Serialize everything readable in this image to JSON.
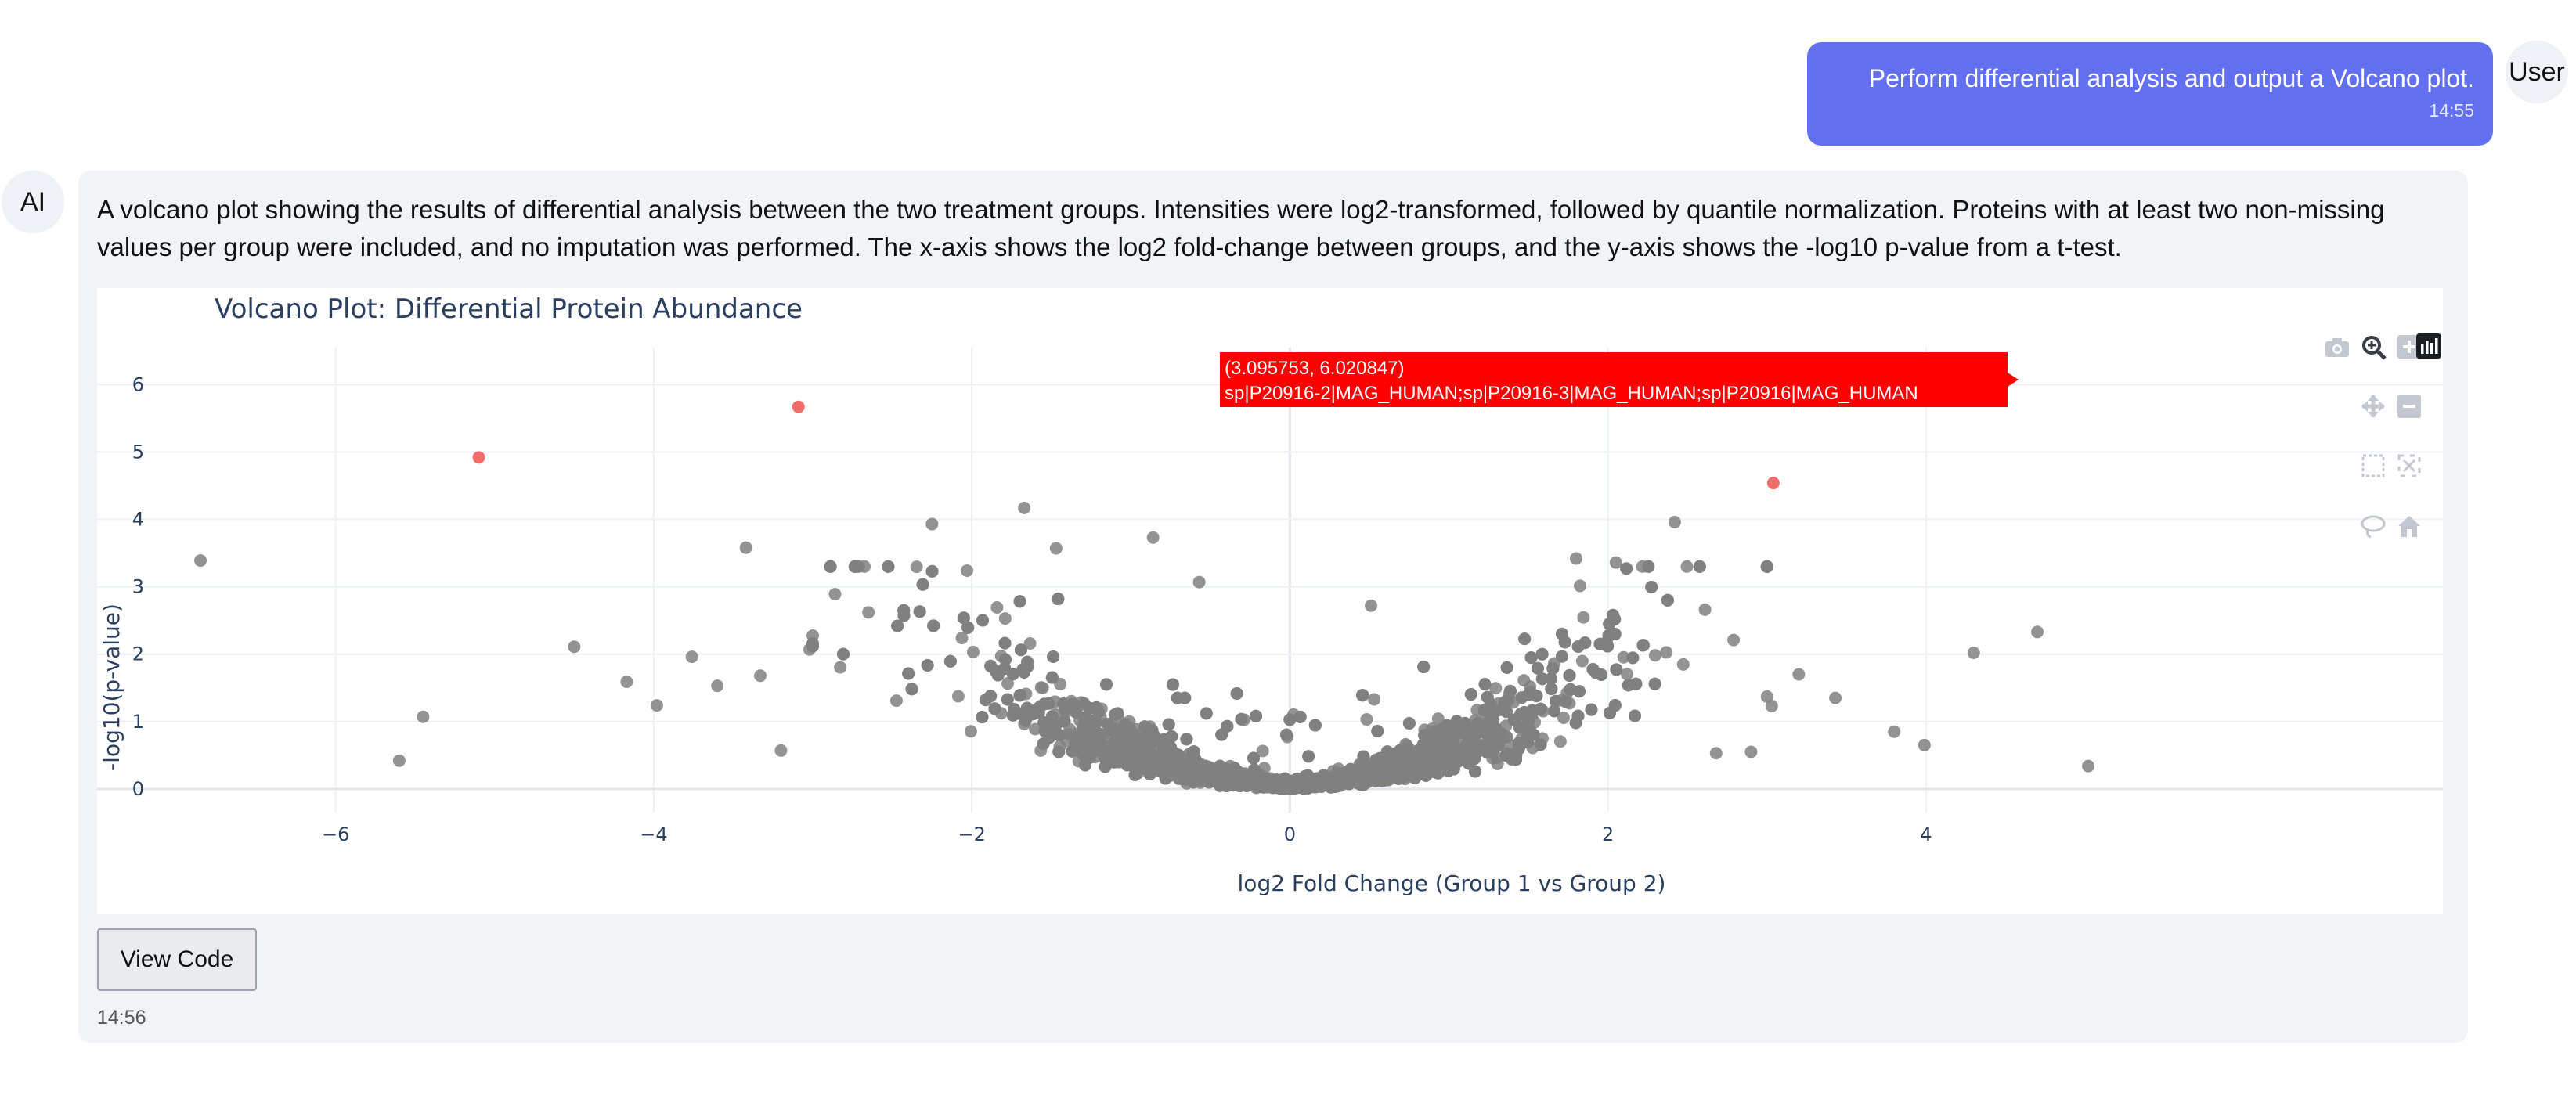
{
  "user_message": {
    "avatar_label": "User",
    "text": "Perform differential analysis and output a Volcano plot.",
    "time": "14:55"
  },
  "ai_message": {
    "avatar_label": "AI",
    "text": "A volcano plot showing the results of differential analysis between the two treatment groups. Intensities were log2-transformed, followed by quantile normalization. Proteins with at least two non-missing values per group were included, and no imputation was performed. The x-axis shows the log2 fold-change between groups, and the y-axis shows the -log10 p-value from a t-test.",
    "view_code_label": "View Code",
    "time": "14:56"
  },
  "toolbar_icons": [
    "camera-icon",
    "zoom-icon",
    "zoom-in-icon",
    "plotly-logo-icon",
    "pan-icon",
    "zoom-out-icon",
    "box-select-icon",
    "autoscale-icon",
    "lasso-icon",
    "home-icon"
  ],
  "chart_data": {
    "type": "scatter",
    "title": "Volcano Plot: Differential Protein Abundance",
    "xlabel": "log2 Fold Change (Group 1 vs Group 2)",
    "ylabel": "-log10(p-value)",
    "xlim": [
      -7.5,
      7.25
    ],
    "ylim": [
      -0.35,
      6.55
    ],
    "x_ticks": [
      -6,
      -4,
      -2,
      0,
      2,
      4
    ],
    "x_tick_labels": [
      "−6",
      "−4",
      "−2",
      "0",
      "2",
      "4"
    ],
    "y_ticks": [
      0,
      1,
      2,
      3,
      4,
      5,
      6
    ],
    "y_tick_labels": [
      "0",
      "1",
      "2",
      "3",
      "4",
      "5",
      "6"
    ],
    "grid": true,
    "colors": {
      "nonsignificant": "#808080",
      "significant": "#ef5350",
      "tooltip": "#ff0000"
    },
    "significant_points": [
      {
        "x": 3.095753,
        "y": 6.020847,
        "label": "sp|P20916-2|MAG_HUMAN;sp|P20916-3|MAG_HUMAN;sp|P20916|MAG_HUMAN"
      },
      {
        "x": -3.09,
        "y": 5.67
      },
      {
        "x": -5.1,
        "y": 4.92
      },
      {
        "x": 3.04,
        "y": 4.54
      }
    ],
    "tooltip": {
      "coords": "(3.095753, 6.020847)",
      "label": "sp|P20916-2|MAG_HUMAN;sp|P20916-3|MAG_HUMAN;sp|P20916|MAG_HUMAN"
    },
    "outlier_points": [
      {
        "x": -6.85,
        "y": 3.39
      },
      {
        "x": -5.6,
        "y": 0.42
      },
      {
        "x": -5.45,
        "y": 1.07
      },
      {
        "x": -4.5,
        "y": 2.11
      },
      {
        "x": -4.17,
        "y": 1.59
      },
      {
        "x": -3.98,
        "y": 1.24
      },
      {
        "x": -3.76,
        "y": 1.96
      },
      {
        "x": -3.6,
        "y": 1.53
      },
      {
        "x": -3.42,
        "y": 3.58
      },
      {
        "x": -3.33,
        "y": 1.68
      },
      {
        "x": -3.2,
        "y": 0.57
      },
      {
        "x": -3.02,
        "y": 2.07
      },
      {
        "x": -2.86,
        "y": 2.89
      },
      {
        "x": -2.65,
        "y": 2.62
      },
      {
        "x": -2.25,
        "y": 3.93
      },
      {
        "x": -1.67,
        "y": 4.17
      },
      {
        "x": -1.47,
        "y": 3.57
      },
      {
        "x": -2.03,
        "y": 3.24
      },
      {
        "x": -0.86,
        "y": 3.73
      },
      {
        "x": -0.57,
        "y": 3.07
      },
      {
        "x": 0.51,
        "y": 2.72
      },
      {
        "x": 1.8,
        "y": 3.42
      },
      {
        "x": 2.05,
        "y": 3.36
      },
      {
        "x": 2.42,
        "y": 3.96
      },
      {
        "x": 2.61,
        "y": 2.66
      },
      {
        "x": 2.79,
        "y": 2.21
      },
      {
        "x": 3.0,
        "y": 1.37
      },
      {
        "x": 3.03,
        "y": 1.23
      },
      {
        "x": 3.2,
        "y": 1.7
      },
      {
        "x": 3.43,
        "y": 1.35
      },
      {
        "x": 3.8,
        "y": 0.85
      },
      {
        "x": 3.99,
        "y": 0.65
      },
      {
        "x": 4.3,
        "y": 2.02
      },
      {
        "x": 4.7,
        "y": 2.33
      },
      {
        "x": 5.02,
        "y": 0.34
      },
      {
        "x": 2.9,
        "y": 0.55
      },
      {
        "x": 2.68,
        "y": 0.53
      }
    ],
    "bulk_summary": {
      "count": 3600,
      "x_range": [
        -3.0,
        3.0
      ],
      "note": "dense V-shaped cloud of non-significant proteins centered near x=0, y=0"
    }
  }
}
